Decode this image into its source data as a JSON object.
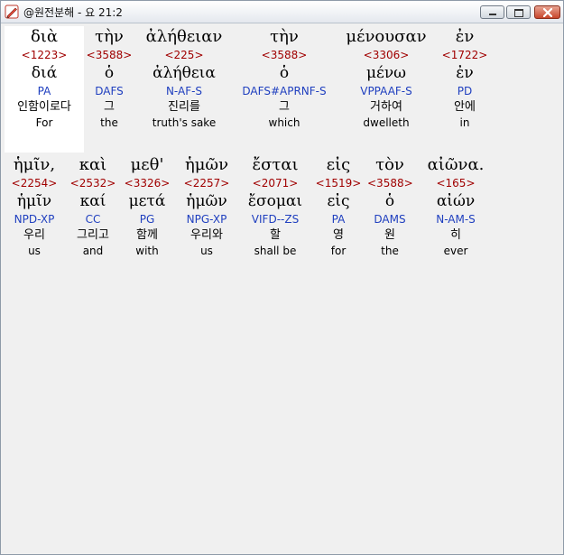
{
  "window": {
    "title": "@원전분해 - 요 21:2"
  },
  "rows": [
    [
      {
        "greek": "διὰ",
        "strong": "<1223>",
        "lemma": "διά",
        "morph": "PA",
        "korean": "인함이로다",
        "english": "For"
      },
      {
        "greek": "τὴν",
        "strong": "<3588>",
        "lemma": "ὁ",
        "morph": "DAFS",
        "korean": "그",
        "english": "the"
      },
      {
        "greek": "ἀλήθειαν",
        "strong": "<225>",
        "lemma": "ἀλήθεια",
        "morph": "N-AF-S",
        "korean": "진리를",
        "english": "truth's sake"
      },
      {
        "greek": "τὴν",
        "strong": "<3588>",
        "lemma": "ὁ",
        "morph": "DAFS#APRNF-S",
        "korean": "그",
        "english": "which"
      },
      {
        "greek": "μένουσαν",
        "strong": "<3306>",
        "lemma": "μένω",
        "morph": "VPPAAF-S",
        "korean": "거하여",
        "english": "dwelleth"
      },
      {
        "greek": "ἐν",
        "strong": "<1722>",
        "lemma": "ἐν",
        "morph": "PD",
        "korean": "안에",
        "english": "in"
      }
    ],
    [
      {
        "greek": "ἡμῖν,",
        "strong": "<2254>",
        "lemma": "ἡμῖν",
        "morph": "NPD-XP",
        "korean": "우리",
        "english": "us"
      },
      {
        "greek": "καὶ",
        "strong": "<2532>",
        "lemma": "καί",
        "morph": "CC",
        "korean": "그리고",
        "english": "and"
      },
      {
        "greek": "μεθ'",
        "strong": "<3326>",
        "lemma": "μετά",
        "morph": "PG",
        "korean": "함께",
        "english": "with"
      },
      {
        "greek": "ἡμῶν",
        "strong": "<2257>",
        "lemma": "ἡμῶν",
        "morph": "NPG-XP",
        "korean": "우리와",
        "english": "us"
      },
      {
        "greek": "ἔσται",
        "strong": "<2071>",
        "lemma": "ἔσομαι",
        "morph": "VIFD--ZS",
        "korean": "할",
        "english": "shall be"
      },
      {
        "greek": "εἰς",
        "strong": "<1519>",
        "lemma": "εἰς",
        "morph": "PA",
        "korean": "영",
        "english": "for"
      },
      {
        "greek": "τὸν",
        "strong": "<3588>",
        "lemma": "ὁ",
        "morph": "DAMS",
        "korean": "원",
        "english": "the"
      },
      {
        "greek": "αἰῶνα.",
        "strong": "<165>",
        "lemma": "αἰών",
        "morph": "N-AM-S",
        "korean": "히",
        "english": "ever"
      }
    ]
  ],
  "colors": {
    "strong": "#a00000",
    "morph": "#1f3fbf",
    "highlight": "#ffffff"
  },
  "icons": {
    "app": "pen-icon",
    "minimize": "minimize-icon",
    "maximize": "maximize-icon",
    "close": "close-icon"
  }
}
